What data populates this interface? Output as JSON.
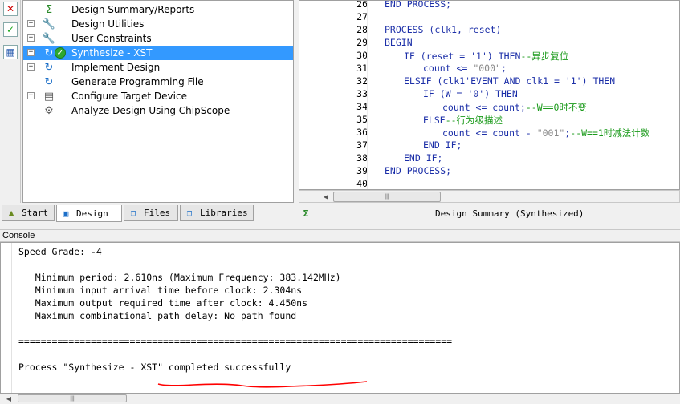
{
  "process_tree": {
    "items": [
      {
        "label": "Design Summary/Reports",
        "icon": "sigma-icon",
        "expandable": false,
        "selected": false
      },
      {
        "label": "Design Utilities",
        "icon": "tools-icon",
        "expandable": true,
        "selected": false
      },
      {
        "label": "User Constraints",
        "icon": "tools-icon",
        "expandable": true,
        "selected": false
      },
      {
        "label": "Synthesize - XST",
        "icon": "process-icon",
        "expandable": true,
        "selected": true,
        "status": "completed"
      },
      {
        "label": "Implement Design",
        "icon": "process-icon",
        "expandable": true,
        "selected": false
      },
      {
        "label": "Generate Programming File",
        "icon": "process-icon",
        "expandable": false,
        "selected": false
      },
      {
        "label": "Configure Target Device",
        "icon": "device-icon",
        "expandable": true,
        "selected": false
      },
      {
        "label": "Analyze Design Using ChipScope",
        "icon": "chipscope-icon",
        "expandable": false,
        "selected": false
      }
    ]
  },
  "code": {
    "lines": [
      {
        "n": "26",
        "indent": 0,
        "parts": [
          {
            "t": "END PROCESS;",
            "c": "kw"
          }
        ]
      },
      {
        "n": "27",
        "indent": 0,
        "parts": []
      },
      {
        "n": "28",
        "indent": 0,
        "parts": [
          {
            "t": "PROCESS",
            "c": "kw"
          },
          {
            "t": " (clk1, reset)",
            "c": "kw"
          }
        ]
      },
      {
        "n": "29",
        "indent": 0,
        "parts": [
          {
            "t": "BEGIN",
            "c": "kw"
          }
        ]
      },
      {
        "n": "30",
        "indent": 1,
        "parts": [
          {
            "t": "IF",
            "c": "kw"
          },
          {
            "t": " (reset = ",
            "c": "kw"
          },
          {
            "t": "'1'",
            "c": "kw"
          },
          {
            "t": ") ",
            "c": "kw"
          },
          {
            "t": "THEN",
            "c": "kw"
          },
          {
            "t": "--异步复位",
            "c": "cm"
          }
        ]
      },
      {
        "n": "31",
        "indent": 2,
        "parts": [
          {
            "t": "count <= ",
            "c": "kw"
          },
          {
            "t": "\"000\"",
            "c": "str"
          },
          {
            "t": ";",
            "c": "kw"
          }
        ]
      },
      {
        "n": "32",
        "indent": 1,
        "parts": [
          {
            "t": "ELSIF",
            "c": "kw"
          },
          {
            "t": " (clk1'EVENT ",
            "c": "kw"
          },
          {
            "t": "AND",
            "c": "kw"
          },
          {
            "t": " clk1 = ",
            "c": "kw"
          },
          {
            "t": "'1'",
            "c": "kw"
          },
          {
            "t": ") ",
            "c": "kw"
          },
          {
            "t": "THEN",
            "c": "kw"
          }
        ]
      },
      {
        "n": "33",
        "indent": 2,
        "parts": [
          {
            "t": "IF",
            "c": "kw"
          },
          {
            "t": " (W = ",
            "c": "kw"
          },
          {
            "t": "'0'",
            "c": "kw"
          },
          {
            "t": ") ",
            "c": "kw"
          },
          {
            "t": "THEN",
            "c": "kw"
          }
        ]
      },
      {
        "n": "34",
        "indent": 3,
        "parts": [
          {
            "t": "count <= count;",
            "c": "kw"
          },
          {
            "t": "--W==0时不变",
            "c": "cm"
          }
        ]
      },
      {
        "n": "35",
        "indent": 2,
        "parts": [
          {
            "t": "ELSE",
            "c": "kw"
          },
          {
            "t": "--行为级描述",
            "c": "cm"
          }
        ]
      },
      {
        "n": "36",
        "indent": 3,
        "parts": [
          {
            "t": "count <= count - ",
            "c": "kw"
          },
          {
            "t": "\"001\"",
            "c": "str"
          },
          {
            "t": ";",
            "c": "kw"
          },
          {
            "t": "--W==1时减法计数",
            "c": "cm"
          }
        ]
      },
      {
        "n": "37",
        "indent": 2,
        "parts": [
          {
            "t": "END IF;",
            "c": "kw"
          }
        ]
      },
      {
        "n": "38",
        "indent": 1,
        "parts": [
          {
            "t": "END IF;",
            "c": "kw"
          }
        ]
      },
      {
        "n": "39",
        "indent": 0,
        "parts": [
          {
            "t": "END PROCESS;",
            "c": "kw"
          }
        ]
      },
      {
        "n": "40",
        "indent": 0,
        "parts": []
      }
    ]
  },
  "tabs_left": [
    {
      "label": "Start",
      "icon": "start-icon",
      "active": false
    },
    {
      "label": "Design",
      "icon": "design-icon",
      "active": true
    },
    {
      "label": "Files",
      "icon": "files-icon",
      "active": false
    },
    {
      "label": "Libraries",
      "icon": "libraries-icon",
      "active": false
    }
  ],
  "tab_right": {
    "label": "Design Summary (Synthesized)",
    "icon": "sigma-icon"
  },
  "console": {
    "title": "Console",
    "lines": [
      "Speed Grade: -4",
      "",
      "   Minimum period: 2.610ns (Maximum Frequency: 383.142MHz)",
      "   Minimum input arrival time before clock: 2.304ns",
      "   Maximum output required time after clock: 4.450ns",
      "   Maximum combinational path delay: No path found",
      "",
      "==============================================================================",
      "",
      "Process \"Synthesize - XST\" completed successfully"
    ]
  },
  "colors": {
    "selection": "#3399ff",
    "keyword": "#1c2fa8",
    "comment": "#1a9a1a",
    "string": "#888888",
    "annotation": "#ff0000"
  }
}
